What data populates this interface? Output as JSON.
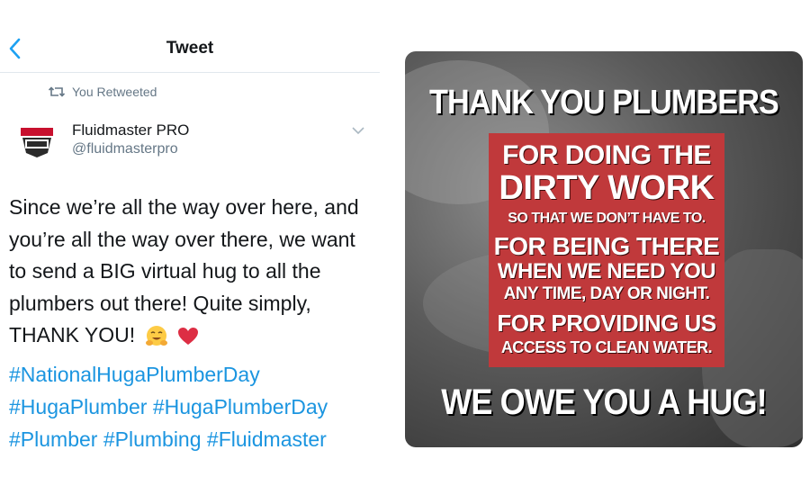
{
  "header": {
    "title": "Tweet",
    "back_icon": "chevron-left-icon"
  },
  "retweet": {
    "label": "You Retweeted",
    "icon": "retweet-icon"
  },
  "author": {
    "name": "Fluidmaster PRO",
    "handle": "@fluidmasterpro"
  },
  "tweet": {
    "lines": [
      "Since we’re all the way over here, and",
      "you’re all the way over there, we want",
      "to send a BIG virtual hug to all the",
      "plumbers out there! Quite simply,",
      "THANK YOU!"
    ],
    "emojis": [
      "hugging-face",
      "red-heart"
    ],
    "hashtags": [
      [
        "#NationalHugaPlumberDay"
      ],
      [
        "#HugaPlumber",
        "#HugaPlumberDay"
      ],
      [
        "#Plumber",
        "#Plumbing",
        "#Fluidmaster"
      ]
    ]
  },
  "image": {
    "headline": "THANK YOU PLUMBERS",
    "box": [
      "FOR DOING THE",
      "DIRTY WORK",
      "SO THAT WE DON’T HAVE TO.",
      "FOR BEING THERE",
      "WHEN WE NEED YOU",
      "ANY TIME, DAY OR NIGHT.",
      "FOR PROVIDING US",
      "ACCESS TO CLEAN WATER."
    ],
    "footer": "WE OWE YOU A HUG!"
  },
  "colors": {
    "link": "#1b95e0",
    "muted": "#657786",
    "box_red": "#c0393b"
  }
}
